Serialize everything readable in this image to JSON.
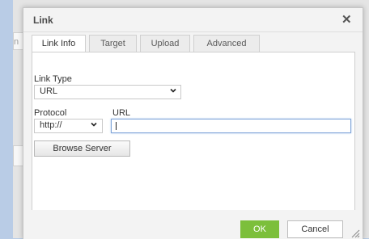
{
  "dialog": {
    "title": "Link",
    "close_icon": "close-icon"
  },
  "tabs": [
    {
      "label": "Link Info",
      "active": true
    },
    {
      "label": "Target",
      "active": false
    },
    {
      "label": "Upload",
      "active": false
    },
    {
      "label": "Advanced",
      "active": false
    }
  ],
  "link_type": {
    "label": "Link Type",
    "value": "URL"
  },
  "protocol": {
    "label": "Protocol",
    "value": "http://"
  },
  "url": {
    "label": "URL",
    "value": ""
  },
  "browse_button": "Browse Server",
  "footer": {
    "ok": "OK",
    "cancel": "Cancel"
  },
  "colors": {
    "ok_button": "#7cbf3b",
    "focus_border": "#7ea4d8"
  }
}
